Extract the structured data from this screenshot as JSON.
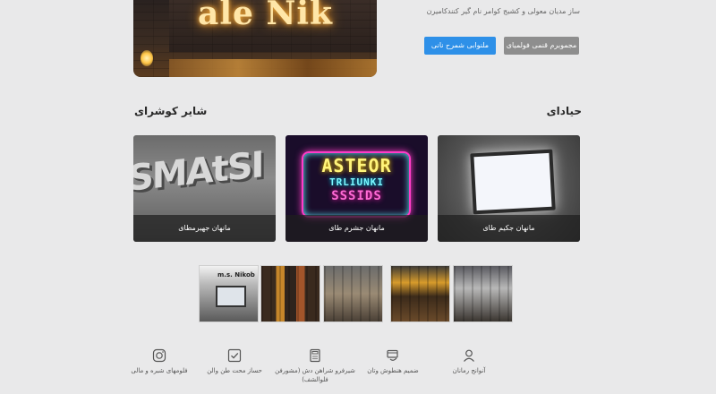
{
  "hero": {
    "sign_text": "ale Nik",
    "subtitle": "ساز مدیان معولی و کشبج کوامر نام گیر کنندکامیرن"
  },
  "buttons": {
    "primary_label": "ملنوابی شمرح نانی",
    "secondary_label": "مجموبرم قنمی فولمیای"
  },
  "sections": {
    "right_title": "حیادای",
    "left_title": "شایر کوشرای"
  },
  "cards": [
    {
      "caption": "مانهان جهیرمطای",
      "art_text": "SMAtSI"
    },
    {
      "caption": "مانهان جشرم طای",
      "art_line1": "ASTEOR",
      "art_line2": "TRLIUNKI",
      "art_line3": "SSSIDS"
    },
    {
      "caption": "مانهان جکیم طای"
    }
  ],
  "thumbnails": [
    {
      "name": "thumb-1",
      "label": "m.s. Nikob"
    },
    {
      "name": "thumb-2"
    },
    {
      "name": "thumb-3"
    },
    {
      "name": "thumb-4"
    },
    {
      "name": "thumb-5"
    }
  ],
  "features": [
    {
      "icon": "instagram-icon",
      "text": "فلومهای شبره و مالی"
    },
    {
      "icon": "checkbox-icon",
      "text": "حساز محت طن والن"
    },
    {
      "icon": "calculator-icon",
      "text": "شیرفرو شراهن دش (مشورفن فلوالشف)"
    },
    {
      "icon": "coins-icon",
      "text": "ضمیم هنطوش وتان"
    },
    {
      "icon": "user-icon",
      "text": "آنوانج رمانان"
    }
  ],
  "colors": {
    "primary_button": "#2e90e8",
    "secondary_button": "#8e8e8e",
    "background": "#e9e9ea"
  }
}
